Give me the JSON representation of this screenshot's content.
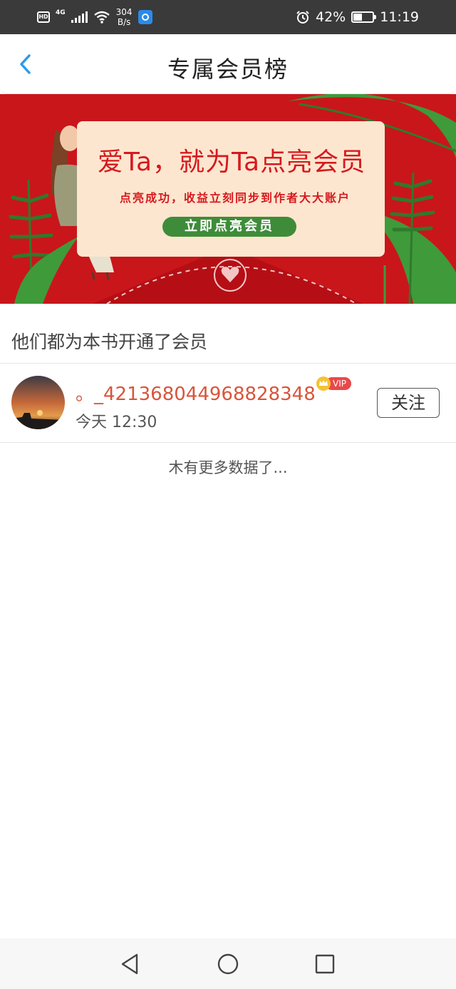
{
  "status_bar": {
    "hd_label": "HD",
    "network": "4G",
    "speed_value": "304",
    "speed_unit": "B/s",
    "battery_percent": "42%",
    "battery_level": 0.42,
    "time": "11:19",
    "icons": [
      "hd-icon",
      "signal-icon",
      "wifi-icon",
      "app-notification-icon",
      "alarm-icon",
      "battery-icon"
    ]
  },
  "header": {
    "title": "专属会员榜",
    "back_icon": "chevron-left-icon"
  },
  "banner": {
    "headline": "爱Ta，就为Ta点亮会员",
    "subtitle": "点亮成功，收益立刻同步到作者大大账户",
    "button_label": "立即点亮会员",
    "colors": {
      "background": "#c9161b",
      "card": "#fde6cf",
      "accent_green": "#3e8c3a"
    }
  },
  "section": {
    "title": "他们都为本书开通了会员"
  },
  "members": [
    {
      "name": "。_421368044968828348",
      "badge": "VIP",
      "time": "今天 12:30",
      "follow_label": "关注"
    }
  ],
  "footer_text": "木有更多数据了...",
  "nav_bar": {
    "icons": [
      "back-triangle-icon",
      "home-circle-icon",
      "recents-square-icon"
    ]
  }
}
